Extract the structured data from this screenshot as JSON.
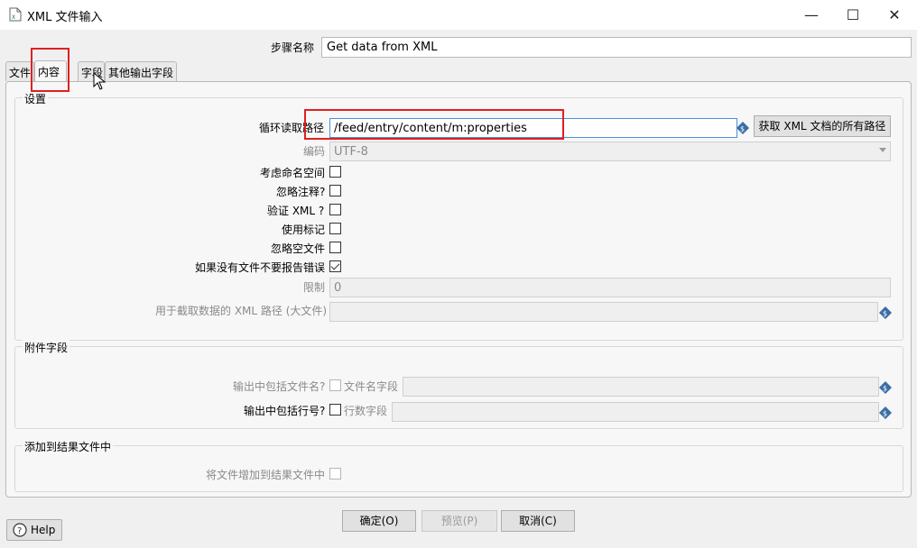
{
  "window": {
    "title": "XML 文件输入",
    "minimize_label": "—",
    "maximize_label": "☐",
    "close_label": "✕"
  },
  "step": {
    "label": "步骤名称",
    "value": "Get data from XML"
  },
  "tabs": [
    {
      "label": "文件"
    },
    {
      "label": "内容"
    },
    {
      "label": "字段"
    },
    {
      "label": "其他输出字段"
    }
  ],
  "settings": {
    "title": "设置",
    "loop_path": {
      "label": "循环读取路径",
      "value": "/feed/entry/content/m:properties",
      "button": "获取 XML 文档的所有路径"
    },
    "encoding": {
      "label": "编码",
      "value": "UTF-8"
    },
    "namespace": {
      "label": "考虑命名空间",
      "checked": false
    },
    "ignore_comments": {
      "label": "忽略注释?",
      "checked": false
    },
    "validate_xml": {
      "label": "验证 XML ?",
      "checked": false
    },
    "use_token": {
      "label": "使用标记",
      "checked": false
    },
    "ignore_empty": {
      "label": "忽略空文件",
      "checked": false
    },
    "no_error_if_no_files": {
      "label": "如果没有文件不要报告错误",
      "checked": true
    },
    "limit": {
      "label": "限制",
      "value": "0"
    },
    "prune_path": {
      "label": "用于截取数据的 XML 路径 (大文件)",
      "value": ""
    }
  },
  "additional_fields": {
    "title": "附件字段",
    "include_filename": {
      "label": "输出中包括文件名?",
      "field_label": "文件名字段",
      "value": ""
    },
    "include_rownum": {
      "label": "输出中包括行号?",
      "field_label": "行数字段",
      "value": ""
    }
  },
  "result_files": {
    "title": "添加到结果文件中",
    "add_files": {
      "label": "将文件增加到结果文件中"
    }
  },
  "buttons": {
    "ok": "确定(O)",
    "preview": "预览(P)",
    "cancel": "取消(C)",
    "help": "Help"
  },
  "colors": {
    "highlight": "#e02020",
    "focus_border": "#4a90d9"
  }
}
